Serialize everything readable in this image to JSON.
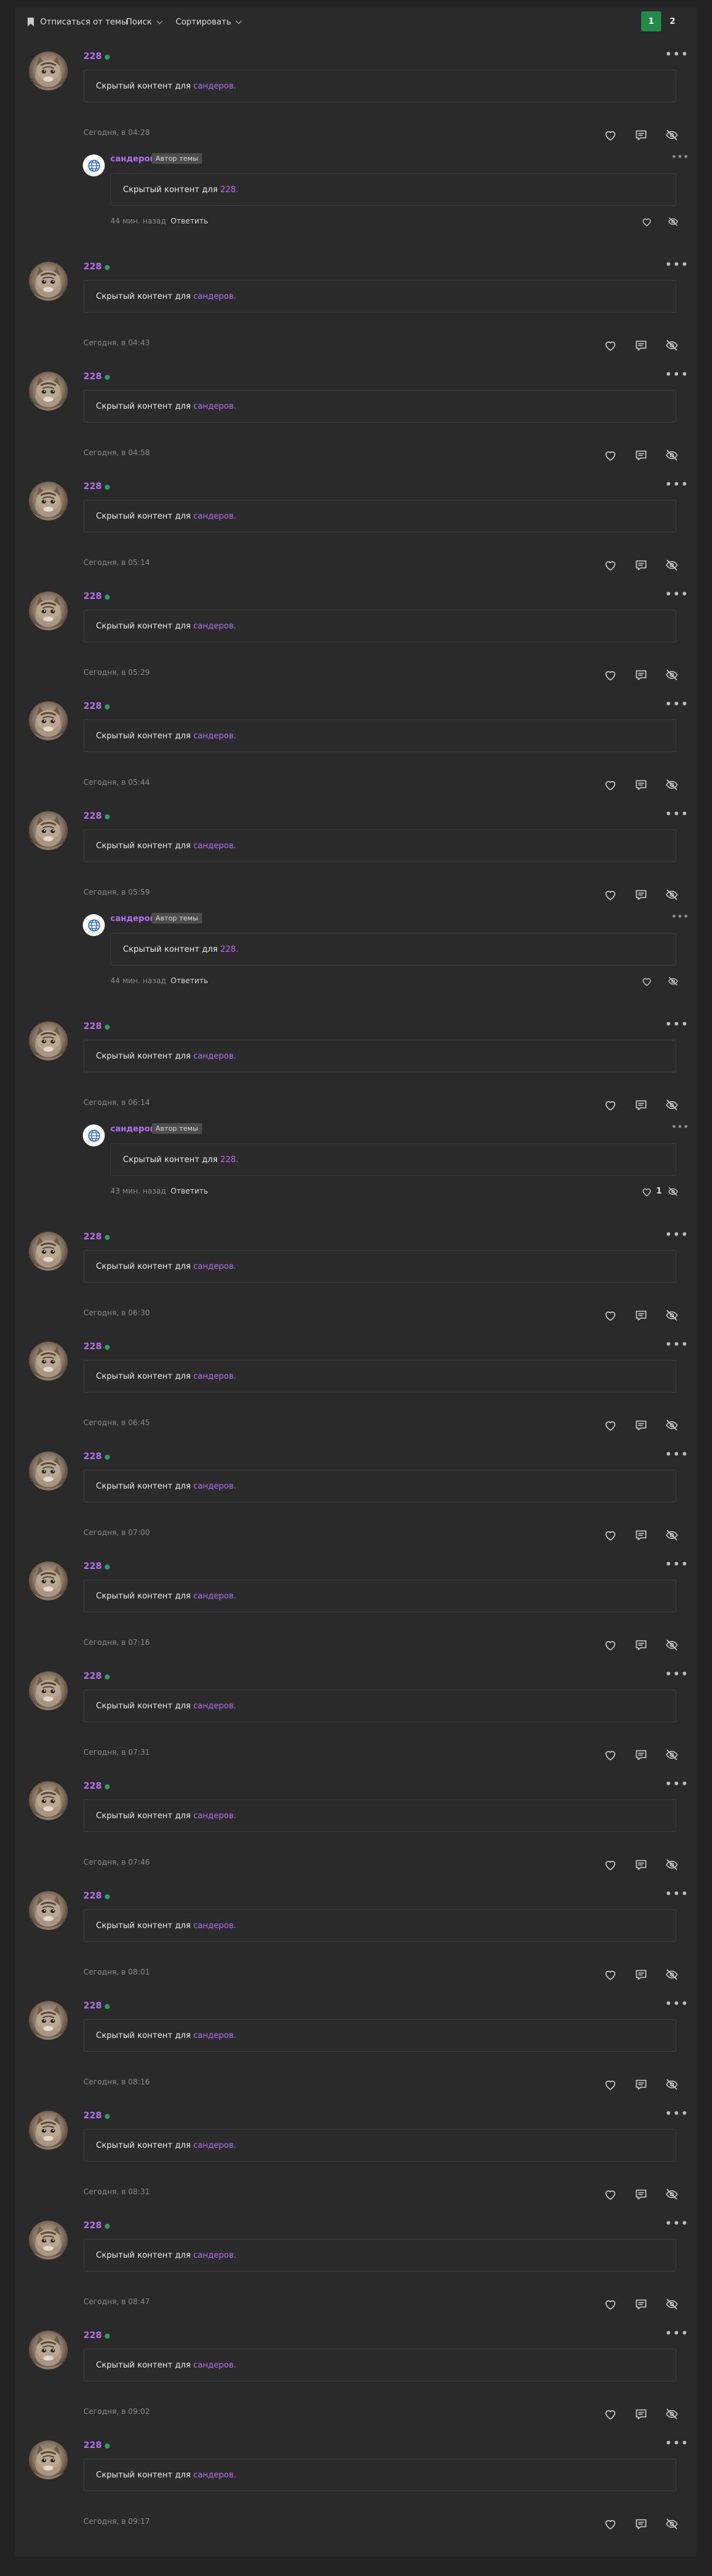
{
  "toolbar": {
    "unsubscribe_label": "Отписаться от темы",
    "search_label": "Поиск",
    "sort_label": "Сортировать",
    "pages": [
      "1",
      "2"
    ]
  },
  "posts": [
    {
      "author": "228",
      "hidden_text": "Скрытый контент для",
      "hidden_link": "сандеров.",
      "date": "Сегодня, в 04:28",
      "reply": {
        "author": "сандеров",
        "badge": "Автор темы",
        "hidden_text": "Скрытый контент для",
        "hidden_link": "228.",
        "time": "44 мин. назад",
        "reply_label": "Ответить",
        "likes": ""
      }
    },
    {
      "author": "228",
      "hidden_text": "Скрытый контент для",
      "hidden_link": "сандеров.",
      "date": "Сегодня, в 04:43"
    },
    {
      "author": "228",
      "hidden_text": "Скрытый контент для",
      "hidden_link": "сандеров.",
      "date": "Сегодня, в 04:58"
    },
    {
      "author": "228",
      "hidden_text": "Скрытый контент для",
      "hidden_link": "сандеров.",
      "date": "Сегодня, в 05:14"
    },
    {
      "author": "228",
      "hidden_text": "Скрытый контент для",
      "hidden_link": "сандеров.",
      "date": "Сегодня, в 05:29"
    },
    {
      "author": "228",
      "hidden_text": "Скрытый контент для",
      "hidden_link": "сандеров.",
      "date": "Сегодня, в 05:44"
    },
    {
      "author": "228",
      "hidden_text": "Скрытый контент для",
      "hidden_link": "сандеров.",
      "date": "Сегодня, в 05:59",
      "reply": {
        "author": "сандеров",
        "badge": "Автор темы",
        "hidden_text": "Скрытый контент для",
        "hidden_link": "228.",
        "time": "44 мин. назад",
        "reply_label": "Ответить",
        "likes": ""
      }
    },
    {
      "author": "228",
      "hidden_text": "Скрытый контент для",
      "hidden_link": "сандеров.",
      "date": "Сегодня, в 06:14",
      "reply": {
        "author": "сандеров",
        "badge": "Автор темы",
        "hidden_text": "Скрытый контент для",
        "hidden_link": "228.",
        "time": "43 мин. назад",
        "reply_label": "Ответить",
        "likes": "1"
      }
    },
    {
      "author": "228",
      "hidden_text": "Скрытый контент для",
      "hidden_link": "сандеров.",
      "date": "Сегодня, в 06:30"
    },
    {
      "author": "228",
      "hidden_text": "Скрытый контент для",
      "hidden_link": "сандеров.",
      "date": "Сегодня, в 06:45"
    },
    {
      "author": "228",
      "hidden_text": "Скрытый контент для",
      "hidden_link": "сандеров.",
      "date": "Сегодня, в 07:00"
    },
    {
      "author": "228",
      "hidden_text": "Скрытый контент для",
      "hidden_link": "сандеров.",
      "date": "Сегодня, в 07:16"
    },
    {
      "author": "228",
      "hidden_text": "Скрытый контент для",
      "hidden_link": "сандеров.",
      "date": "Сегодня, в 07:31"
    },
    {
      "author": "228",
      "hidden_text": "Скрытый контент для",
      "hidden_link": "сандеров.",
      "date": "Сегодня, в 07:46"
    },
    {
      "author": "228",
      "hidden_text": "Скрытый контент для",
      "hidden_link": "сандеров.",
      "date": "Сегодня, в 08:01"
    },
    {
      "author": "228",
      "hidden_text": "Скрытый контент для",
      "hidden_link": "сандеров.",
      "date": "Сегодня, в 08:16"
    },
    {
      "author": "228",
      "hidden_text": "Скрытый контент для",
      "hidden_link": "сандеров.",
      "date": "Сегодня, в 08:31"
    },
    {
      "author": "228",
      "hidden_text": "Скрытый контент для",
      "hidden_link": "сандеров.",
      "date": "Сегодня, в 08:47"
    },
    {
      "author": "228",
      "hidden_text": "Скрытый контент для",
      "hidden_link": "сандеров.",
      "date": "Сегодня, в 09:02"
    },
    {
      "author": "228",
      "hidden_text": "Скрытый контент для",
      "hidden_link": "сандеров.",
      "date": "Сегодня, в 09:17"
    }
  ],
  "icons": {
    "like": "heart-icon",
    "comment": "comment-icon",
    "hide": "eye-off-icon",
    "more": "more-dots-icon",
    "author_avatar": "globe-avatar-icon",
    "bookmark": "bookmark-icon"
  },
  "colors": {
    "background": "#232323",
    "panel": "#2a2a2a",
    "username": "#b370ef",
    "online": "#2e9e63",
    "active_page": "#238a4b"
  }
}
